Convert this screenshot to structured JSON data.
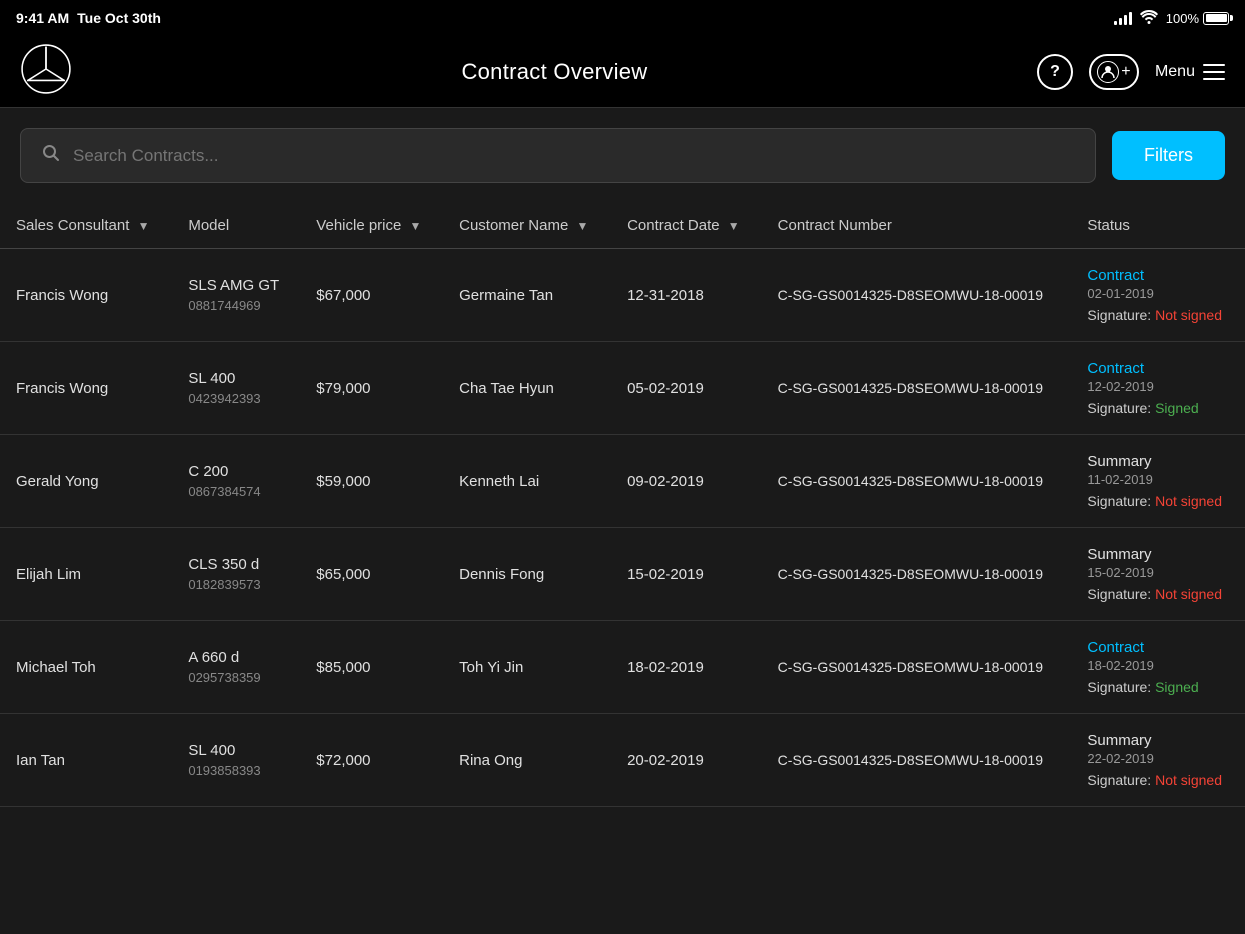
{
  "statusBar": {
    "time": "9:41 AM",
    "date": "Tue Oct 30th",
    "battery": "100%"
  },
  "header": {
    "title": "Contract Overview",
    "helpLabel": "?",
    "menuLabel": "Menu"
  },
  "search": {
    "placeholder": "Search Contracts...",
    "filtersLabel": "Filters"
  },
  "table": {
    "columns": [
      {
        "key": "sales_consultant",
        "label": "Sales Consultant",
        "sortable": true
      },
      {
        "key": "model",
        "label": "Model",
        "sortable": false
      },
      {
        "key": "vehicle_price",
        "label": "Vehicle price",
        "sortable": true
      },
      {
        "key": "customer_name",
        "label": "Customer Name",
        "sortable": true
      },
      {
        "key": "contract_date",
        "label": "Contract Date",
        "sortable": true
      },
      {
        "key": "contract_number",
        "label": "Contract Number",
        "sortable": false
      },
      {
        "key": "status",
        "label": "Status",
        "sortable": false
      }
    ],
    "rows": [
      {
        "sales_consultant": "Francis Wong",
        "model": "SLS AMG GT",
        "model_phone": "0881744969",
        "vehicle_price": "$67,000",
        "customer_name": "Germaine Tan",
        "contract_date": "12-31-2018",
        "contract_number": "C-SG-GS0014325-D8SEOMWU-18-00019",
        "status_type": "Contract",
        "status_class": "contract",
        "status_date": "02-01-2019",
        "signature_label": "Signature:",
        "signature_value": "Not signed",
        "signature_class": "sig-not-signed"
      },
      {
        "sales_consultant": "Francis Wong",
        "model": "SL 400",
        "model_phone": "0423942393",
        "vehicle_price": "$79,000",
        "customer_name": "Cha Tae Hyun",
        "contract_date": "05-02-2019",
        "contract_number": "C-SG-GS0014325-D8SEOMWU-18-00019",
        "status_type": "Contract",
        "status_class": "contract",
        "status_date": "12-02-2019",
        "signature_label": "Signature:",
        "signature_value": "Signed",
        "signature_class": "sig-signed"
      },
      {
        "sales_consultant": "Gerald Yong",
        "model": "C 200",
        "model_phone": "0867384574",
        "vehicle_price": "$59,000",
        "customer_name": "Kenneth Lai",
        "contract_date": "09-02-2019",
        "contract_number": "C-SG-GS0014325-D8SEOMWU-18-00019",
        "status_type": "Summary",
        "status_class": "summary",
        "status_date": "11-02-2019",
        "signature_label": "Signature:",
        "signature_value": "Not signed",
        "signature_class": "sig-not-signed"
      },
      {
        "sales_consultant": "Elijah Lim",
        "model": "CLS 350 d",
        "model_phone": "0182839573",
        "vehicle_price": "$65,000",
        "customer_name": "Dennis Fong",
        "contract_date": "15-02-2019",
        "contract_number": "C-SG-GS0014325-D8SEOMWU-18-00019",
        "status_type": "Summary",
        "status_class": "summary",
        "status_date": "15-02-2019",
        "signature_label": "Signature:",
        "signature_value": "Not signed",
        "signature_class": "sig-not-signed"
      },
      {
        "sales_consultant": "Michael Toh",
        "model": "A 660 d",
        "model_phone": "0295738359",
        "vehicle_price": "$85,000",
        "customer_name": "Toh Yi Jin",
        "contract_date": "18-02-2019",
        "contract_number": "C-SG-GS0014325-D8SEOMWU-18-00019",
        "status_type": "Contract",
        "status_class": "contract",
        "status_date": "18-02-2019",
        "signature_label": "Signature:",
        "signature_value": "Signed",
        "signature_class": "sig-signed"
      },
      {
        "sales_consultant": "Ian Tan",
        "model": "SL 400",
        "model_phone": "0193858393",
        "vehicle_price": "$72,000",
        "customer_name": "Rina Ong",
        "contract_date": "20-02-2019",
        "contract_number": "C-SG-GS0014325-D8SEOMWU-18-00019",
        "status_type": "Summary",
        "status_class": "summary",
        "status_date": "22-02-2019",
        "signature_label": "Signature:",
        "signature_value": "Not signed",
        "signature_class": "sig-not-signed"
      }
    ]
  }
}
